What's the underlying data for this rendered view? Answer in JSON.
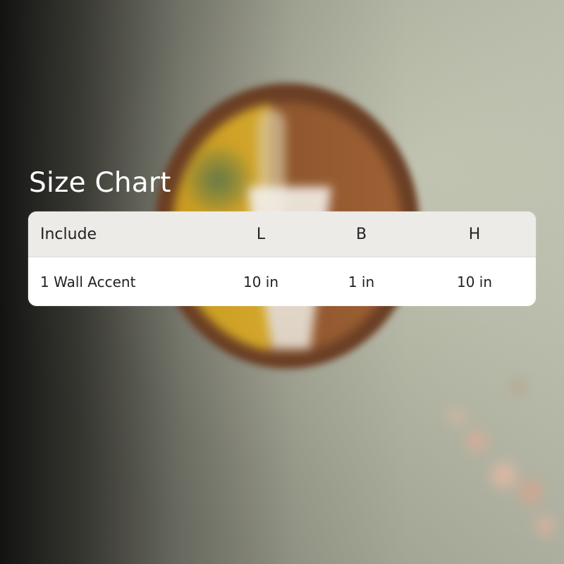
{
  "title": "Size Chart",
  "table": {
    "headers": [
      "Include",
      "L",
      "B",
      "H"
    ],
    "rows": [
      {
        "include": "1 Wall Accent",
        "l": "10 in",
        "b": "1 in",
        "h": "10 in"
      }
    ]
  },
  "colors": {
    "title_text": "#ffffff",
    "header_background": "#ecebe7",
    "row_background": "#ffffff",
    "table_text": "#222222"
  },
  "icons": {
    "background_subject": "circular-wall-accent-image",
    "foreground_subject": "blurred-flowers-image"
  }
}
